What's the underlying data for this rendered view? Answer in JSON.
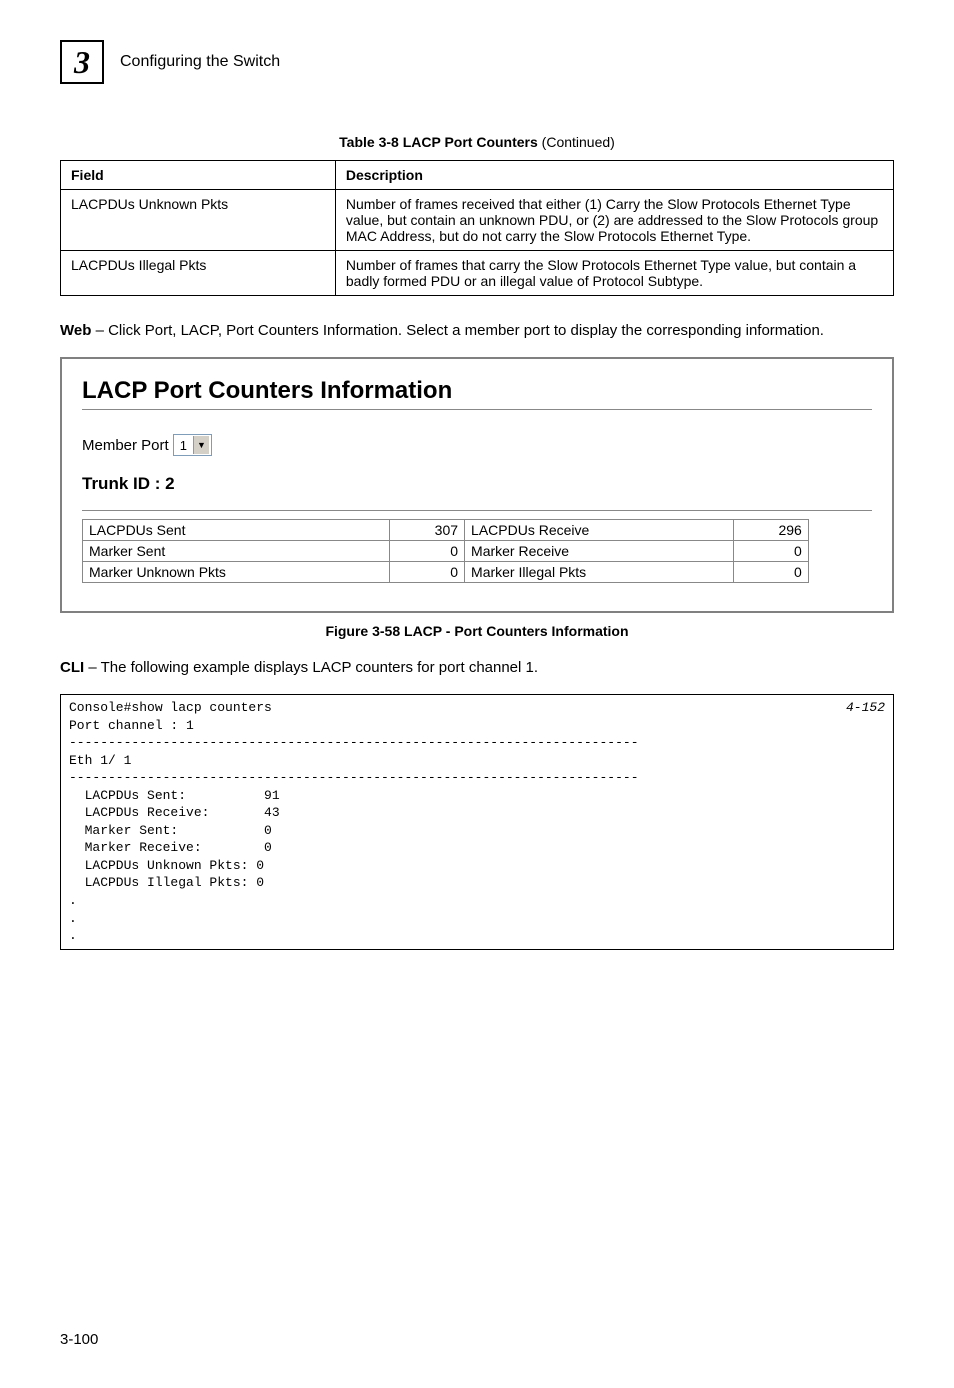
{
  "header": {
    "chapter_number": "3",
    "section_title": "Configuring the Switch"
  },
  "counter_table": {
    "caption_prefix": "Table 3-8  LACP Port Counters",
    "caption_suffix": "  (Continued)",
    "header_field": "Field",
    "header_desc": "Description",
    "rows": [
      {
        "field": "LACPDUs Unknown Pkts",
        "desc": "Number of frames received that either (1) Carry the Slow Protocols Ethernet Type value, but contain an unknown PDU, or (2) are addressed to the Slow Protocols group MAC Address, but do not carry the Slow Protocols Ethernet Type."
      },
      {
        "field": "LACPDUs Illegal Pkts",
        "desc": "Number of frames that carry the Slow Protocols Ethernet Type value, but contain a badly formed PDU or an illegal value of Protocol Subtype."
      }
    ]
  },
  "web_paragraph": {
    "prefix": "Web",
    "text": " – Click Port, LACP, Port Counters Information. Select a member port to display the corresponding information."
  },
  "panel": {
    "title": "LACP Port Counters Information",
    "member_label": "Member Port",
    "member_value": "1",
    "trunk_label": "Trunk ID : 2",
    "stats": [
      {
        "c1": "LACPDUs Sent",
        "c2": "307",
        "c3": "LACPDUs Receive",
        "c4": "296"
      },
      {
        "c1": "Marker Sent",
        "c2": "0",
        "c3": "Marker Receive",
        "c4": "0"
      },
      {
        "c1": "Marker Unknown Pkts",
        "c2": "0",
        "c3": "Marker Illegal Pkts",
        "c4": "0"
      }
    ]
  },
  "figure_caption": "Figure 3-58  LACP - Port Counters Information",
  "cli_paragraph": {
    "prefix": "CLI",
    "text": " – The following example displays LACP counters for port channel 1."
  },
  "cli": {
    "ref": "4-152",
    "lines": "Console#show lacp counters\nPort channel : 1\n-------------------------------------------------------------------------\nEth 1/ 1\n-------------------------------------------------------------------------\n  LACPDUs Sent:          91\n  LACPDUs Receive:       43\n  Marker Sent:           0\n  Marker Receive:        0\n  LACPDUs Unknown Pkts: 0\n  LACPDUs Illegal Pkts: 0\n.\n.\n."
  },
  "page_number": "3-100"
}
